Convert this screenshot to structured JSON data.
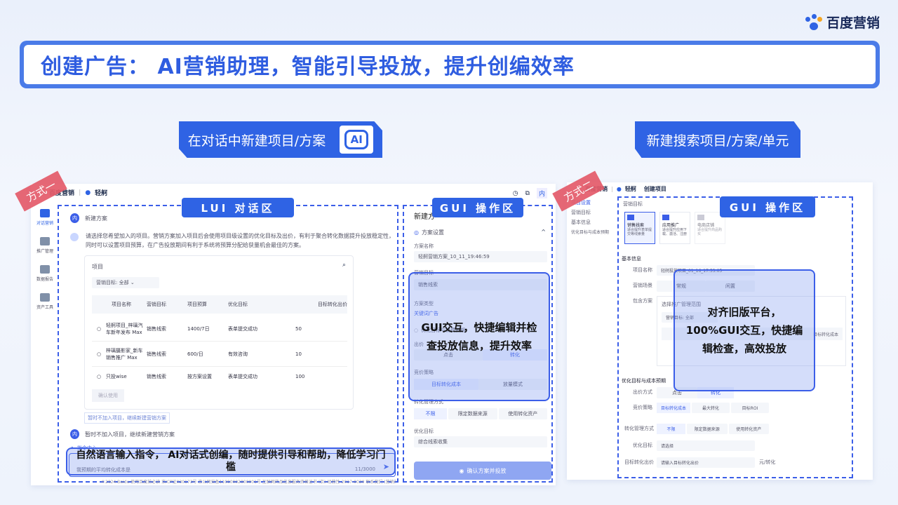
{
  "brand": {
    "logo_text": "百度营销"
  },
  "title": "创建广告： AI营销助理，智能引导投放，提升创编效率",
  "sections": {
    "left_header": "在对话中新建项目/方案",
    "left_badge": "AI",
    "right_header": "新建搜索项目/方案/单元"
  },
  "left_panel": {
    "mode_tag": "方式一",
    "app_brand": "百度营销",
    "app_name": "轻舸",
    "lui_label": "LUI 对话区",
    "gui_label": "GUI 操作区",
    "sidebar": [
      "对话营销",
      "推广管理",
      "数据报告",
      "资产工具"
    ],
    "chat": {
      "user_badge": "内",
      "user_msg": "新建方案",
      "bot_msg": "请选择您希望加入的项目。营销方案加入项目后会使用项目级设置的优化目标及出价，有利于聚合转化数据提升投放稳定性，同时可以设置项目预算，在广告投放期间有利于系统将预算分配给获量机会最佳的方案。",
      "project_label": "项目",
      "filter": "营销目标: 全部",
      "table_headers": [
        "项目名称",
        "营销目标",
        "项目预算",
        "优化目标",
        "目标转化出价"
      ],
      "rows": [
        [
          "轻舸项目_梓璃汽车新年发布 Max",
          "销售线索",
          "1400/7日",
          "表单提交成功",
          "50"
        ],
        [
          "梓璃摄影家_新车销售推广 Max",
          "销售线索",
          "600/日",
          "有效咨询",
          "10"
        ],
        [
          "只投wise",
          "销售线索",
          "按方案设置",
          "表单提交成功",
          "100"
        ]
      ],
      "confirm_btn": "确认使用",
      "skip_link": "暂时不加入项目，继续新建营销方案",
      "user_msg2": "暂时不加入项目，继续新建营销方案",
      "cmd_center": "指令中心",
      "input_placeholder": "我预期的平均转化成本是",
      "counter": "11/3000",
      "footer": "©2024 Baidu 使用百度前必读 京ICP证030173号 京公网安备11000002000001号 互联网药品信息服务资格证书 (京)-经营性-2017-0020 联系我们 (营销热线) 400-890-0088"
    },
    "overlay_lui": "自然语言输入指令， AI对话式创编，随时提供引导和帮助，降低学习门槛",
    "gui": {
      "top_title": "新建方",
      "section": "方案设置",
      "name_label": "方案名称",
      "name_value": "轻舸营销方案_10_11_19:46:59",
      "goal_label": "营销目标",
      "goal_value": "销售线索",
      "type_label": "方案类型",
      "type_value": "关键词广告",
      "opt_label": "优化目标与消费预期",
      "bid_label": "出价",
      "bid_opts": [
        "点击",
        "转化"
      ],
      "strategy_label": "竞价策略",
      "strategy_opts": [
        "目标转化成本",
        "放量模式"
      ],
      "conv_label": "转化管理方式",
      "conv_opts": [
        "不限",
        "限定数据来源",
        "使用转化资产"
      ],
      "optim_label": "优化目标",
      "optim_value": "综合线索收集",
      "confirm": "确认方案并投放"
    },
    "overlay_gui": "GUI交互，快捷编辑并检查投放信息，提升效率",
    "top_icons": [
      "内"
    ]
  },
  "right_panel": {
    "mode_tag": "方式二",
    "app_brand": "百度营销",
    "app_name": "轻舸",
    "page_title": "创建项目",
    "gui_label": "GUI 操作区",
    "nav": [
      "项目设置",
      "营销目标",
      "基本信息",
      "优化目标与成本预期"
    ],
    "goal_label": "营销目标",
    "cards": [
      {
        "title": "销售线索",
        "desc": "适合提升表单提交等线索量"
      },
      {
        "title": "应用推广",
        "desc": "适合提升应用下载、激活、注册"
      },
      {
        "title": "电商店铺",
        "desc": "适合提升商品购买"
      }
    ],
    "basic_title": "基本信息",
    "proj_name_label": "项目名称",
    "proj_name_value": "轻舸投放项目_01_16_17:53:05",
    "scene_label": "营销场景",
    "scene_opts": [
      "常规",
      "闲置"
    ],
    "scheme_label": "包含方案",
    "scheme_sub": "选择推广管理范围",
    "scheme_btn": "营销目标: 全部",
    "scheme_col": "目标转化成本",
    "optim_title": "优化目标与成本预期",
    "bid_label": "出价方式",
    "bid_opts": [
      "点击",
      "转化"
    ],
    "strategy_label": "竞价策略",
    "strategy_opts": [
      "目标转化成本",
      "最大转化",
      "目标ROI"
    ],
    "conv_label": "转化管理方式",
    "conv_opts": [
      "不限",
      "限定数据来源",
      "使用转化资产"
    ],
    "optim_label": "优化目标",
    "optim_value": "请选择",
    "target_label": "目标转化出价",
    "target_value": "请输入目标转化出价",
    "target_unit": "元/转化"
  },
  "overlay_right": "对齐旧版平台，100%GUI交互，快捷编辑检查，高效投放"
}
